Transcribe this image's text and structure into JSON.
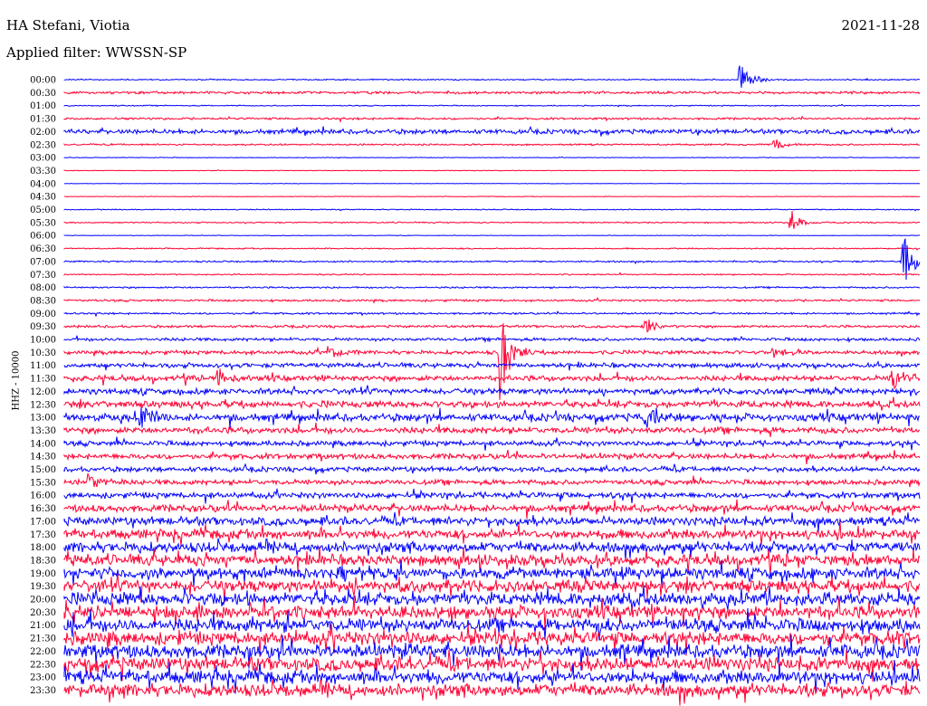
{
  "header": {
    "station": "HA Stefani, Viotia",
    "date": "2021-11-28",
    "filter": "Applied filter: WWSSN-SP"
  },
  "colors": {
    "blue": "#0000ff",
    "red": "#ff0033"
  },
  "chart_data": {
    "type": "line",
    "ylabel": "HHZ - 10000",
    "rows": [
      "00:00",
      "00:30",
      "01:00",
      "01:30",
      "02:00",
      "02:30",
      "03:00",
      "03:30",
      "04:00",
      "04:30",
      "05:00",
      "05:30",
      "06:00",
      "06:30",
      "07:00",
      "07:30",
      "08:00",
      "08:30",
      "09:00",
      "09:30",
      "10:00",
      "10:30",
      "11:00",
      "11:30",
      "12:00",
      "12:30",
      "13:00",
      "13:30",
      "14:00",
      "14:30",
      "15:00",
      "15:30",
      "16:00",
      "16:30",
      "17:00",
      "17:30",
      "18:00",
      "18:30",
      "19:00",
      "19:30",
      "20:00",
      "20:30",
      "21:00",
      "21:30",
      "22:00",
      "22:30",
      "23:00",
      "23:30"
    ],
    "noise_level": [
      0.6,
      1.2,
      0.5,
      1.0,
      2.2,
      0.8,
      0.3,
      0.3,
      0.2,
      0.3,
      0.5,
      0.6,
      0.3,
      0.6,
      0.8,
      0.6,
      0.8,
      1.0,
      0.9,
      1.2,
      1.5,
      1.8,
      2.2,
      2.6,
      2.8,
      3.2,
      3.6,
      3.0,
      2.4,
      2.6,
      2.4,
      2.4,
      2.8,
      3.4,
      4.0,
      4.4,
      4.8,
      5.2,
      5.4,
      5.6,
      6.0,
      6.0,
      6.2,
      6.2,
      6.4,
      6.4,
      6.0,
      5.8
    ],
    "events": [
      {
        "row": 0,
        "x": 0.79,
        "amp": 14
      },
      {
        "row": 5,
        "x": 0.83,
        "amp": 6
      },
      {
        "row": 11,
        "x": 0.85,
        "amp": 10
      },
      {
        "row": 14,
        "x": 0.98,
        "amp": 28
      },
      {
        "row": 19,
        "x": 0.68,
        "amp": 8
      },
      {
        "row": 21,
        "x": 0.51,
        "amp": 40
      },
      {
        "row": 21,
        "x": 0.31,
        "amp": 6
      },
      {
        "row": 21,
        "x": 0.83,
        "amp": 6
      },
      {
        "row": 23,
        "x": 0.18,
        "amp": 8
      },
      {
        "row": 23,
        "x": 0.97,
        "amp": 10
      },
      {
        "row": 26,
        "x": 0.09,
        "amp": 12
      },
      {
        "row": 26,
        "x": 0.68,
        "amp": 10
      },
      {
        "row": 31,
        "x": 0.03,
        "amp": 8
      }
    ]
  }
}
